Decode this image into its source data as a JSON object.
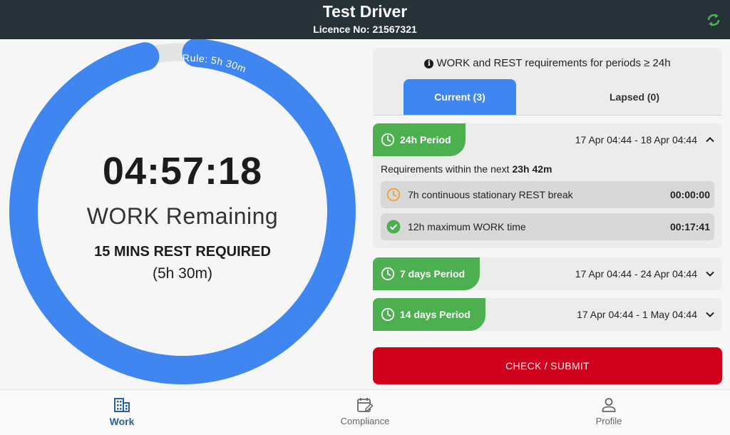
{
  "header": {
    "driver_name": "Test Driver",
    "licence": "Licence No: 21567321",
    "sync_icon": "sync-icon"
  },
  "ring": {
    "progress_fraction": 0.948,
    "rule_label": "Rule: 5h 30m",
    "timer": "04:57:18",
    "remaining_label": "WORK Remaining",
    "rest_required": "15 MINS REST REQUIRED",
    "rest_duration": "(5h 30m)",
    "colors": {
      "progress": "#3f86f0",
      "track": "#e4e4e4"
    }
  },
  "requirements": {
    "heading": "WORK and REST requirements for periods ≥ 24h",
    "tabs": [
      {
        "label": "Current (3)",
        "active": true
      },
      {
        "label": "Lapsed (0)",
        "active": false
      }
    ]
  },
  "periods": [
    {
      "label": "24h Period",
      "range": "17 Apr 04:44 - 18 Apr 04:44",
      "expanded": true,
      "within_prefix": "Requirements within the next ",
      "within_value": "23h 42m",
      "items": [
        {
          "icon": "clock-pending-icon",
          "text": "7h continuous stationary REST break",
          "value": "00:00:00",
          "status_color": "#f0a030"
        },
        {
          "icon": "check-circle-icon",
          "text": "12h maximum WORK time",
          "value": "00:17:41",
          "status_color": "#4caf50"
        }
      ]
    },
    {
      "label": "7 days Period",
      "range": "17 Apr 04:44 - 24 Apr 04:44",
      "expanded": false
    },
    {
      "label": "14 days Period",
      "range": "17 Apr 04:44 - 1 May 04:44",
      "expanded": false
    }
  ],
  "submit_label": "CHECK / SUBMIT",
  "nav": [
    {
      "label": "Work",
      "icon": "building-icon",
      "active": true
    },
    {
      "label": "Compliance",
      "icon": "calendar-edit-icon",
      "active": false
    },
    {
      "label": "Profile",
      "icon": "person-icon",
      "active": false
    }
  ],
  "colors": {
    "header_bg": "#263238",
    "accent_blue": "#3f86f0",
    "period_green": "#4caf50",
    "submit_red": "#d0021b",
    "nav_active": "#2d5f97"
  }
}
